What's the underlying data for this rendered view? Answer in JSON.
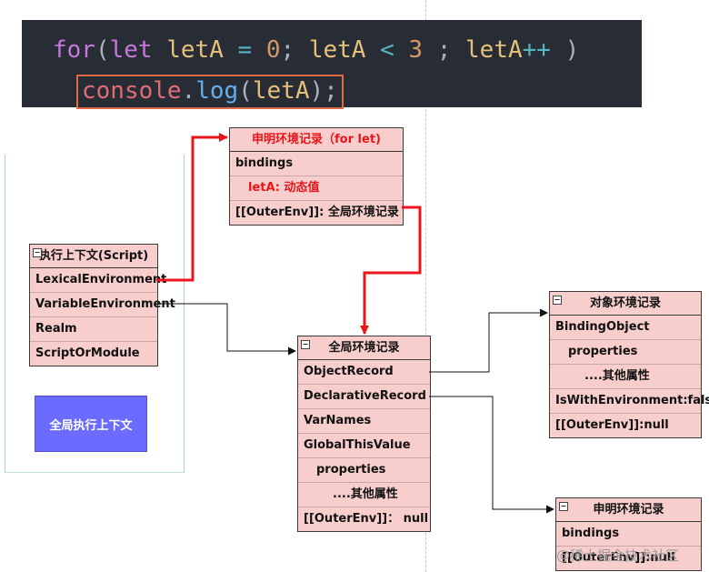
{
  "code": {
    "line1": {
      "for": "for",
      "open": "(",
      "let": "let",
      "var": "letA",
      "eq": "=",
      "zero": "0",
      "semi1": ";",
      "var2": "letA",
      "lt": "<",
      "three": "3",
      "semi2": ";",
      "var3": "letA",
      "inc": "++",
      "close": ")"
    },
    "line2": {
      "obj": "console",
      "dot": ".",
      "fn": "log",
      "open": "(",
      "arg": "letA",
      "close": ");"
    }
  },
  "exec_context": {
    "title": "执行上下文(Script)",
    "rows": [
      "LexicalEnvironment",
      "VariableEnvironment",
      "Realm",
      "ScriptOrModule"
    ]
  },
  "global_context_label": "全局执行上下文",
  "decl_record_for_let": {
    "title": "申明环境记录（for let)",
    "rows": [
      "bindings",
      "letA: 动态值",
      "[[OuterEnv]]: 全局环境记录"
    ]
  },
  "global_env_record": {
    "title": "全局环境记录",
    "rows": [
      "ObjectRecord",
      "DeclarativeRecord",
      "VarNames",
      "GlobalThisValue",
      "properties",
      "....其他属性",
      "[[OuterEnv]]：  null"
    ]
  },
  "object_env_record": {
    "title": "对象环境记录",
    "rows": [
      "BindingObject",
      "properties",
      "....其他属性",
      "IsWithEnvironment:false",
      "[[OuterEnv]]:null"
    ]
  },
  "decl_env_record": {
    "title": "申明环境记录",
    "rows": [
      "bindings",
      "[[OuterEnv]]:null"
    ]
  },
  "watermark": "@稀土掘金技术社区",
  "colors": {
    "record_fill": "#f8cecc",
    "accent_red": "#e8151b",
    "context_box": "#6b6bff",
    "code_bg": "#282c34"
  }
}
